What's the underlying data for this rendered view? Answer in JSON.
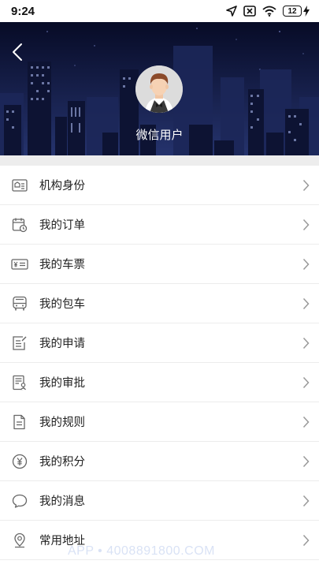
{
  "status_bar": {
    "time": "9:24",
    "battery_level": "12",
    "icons": [
      "location-arrow-icon",
      "no-sim-icon",
      "wifi-icon",
      "battery-icon",
      "charging-bolt-icon"
    ]
  },
  "header": {
    "back_icon": "chevron-left-icon",
    "avatar": "user-avatar-illustration",
    "user_name": "微信用户"
  },
  "menu": {
    "items": [
      {
        "label": "机构身份",
        "icon": "institution-card-icon"
      },
      {
        "label": "我的订单",
        "icon": "order-calendar-icon"
      },
      {
        "label": "我的车票",
        "icon": "ticket-yen-icon"
      },
      {
        "label": "我的包车",
        "icon": "bus-icon"
      },
      {
        "label": "我的申请",
        "icon": "application-edit-icon"
      },
      {
        "label": "我的审批",
        "icon": "approval-document-icon"
      },
      {
        "label": "我的规则",
        "icon": "rules-document-icon"
      },
      {
        "label": "我的积分",
        "icon": "points-yen-circle-icon"
      },
      {
        "label": "我的消息",
        "icon": "message-bubble-icon"
      },
      {
        "label": "常用地址",
        "icon": "location-pin-icon"
      }
    ]
  },
  "watermark": "APP • 4008891800.COM",
  "colors": {
    "header_top": "#0b1030",
    "header_bottom": "#23316a",
    "icon_gray": "#666666",
    "divider": "#ececec"
  }
}
